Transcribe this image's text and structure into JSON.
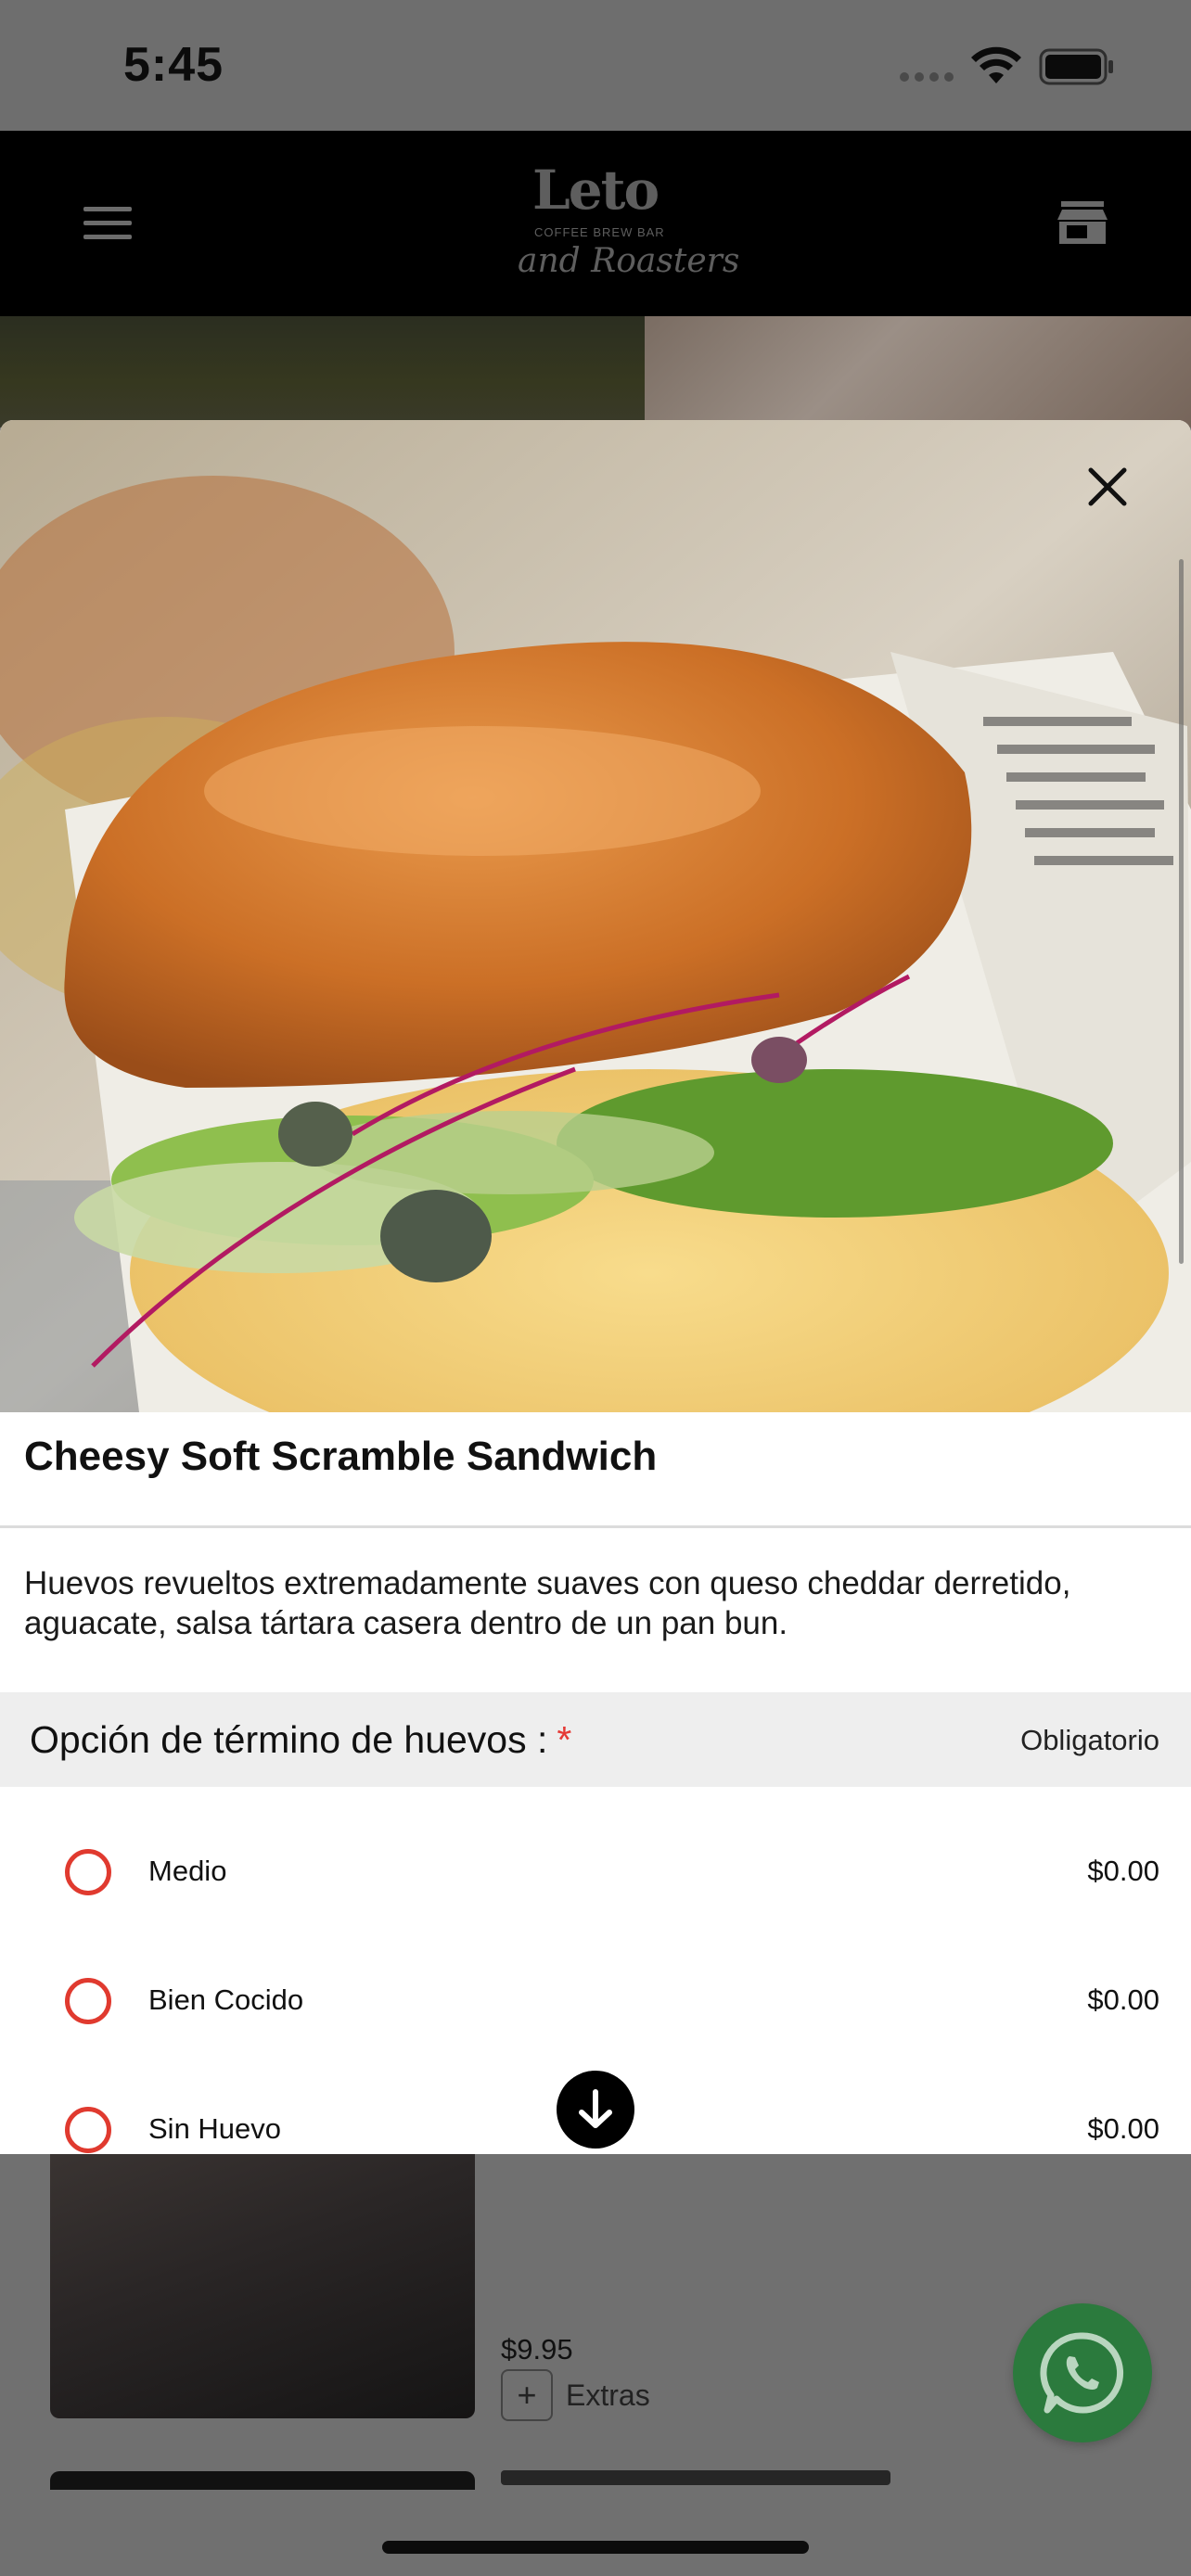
{
  "status_bar": {
    "time": "5:45"
  },
  "header": {
    "logo_main": "Leto",
    "logo_sub": "COFFEE BREW BAR",
    "logo_script": "and Roasters"
  },
  "product": {
    "title": "Cheesy Soft Scramble Sandwich",
    "description": "Huevos revueltos extremadamente suaves con queso cheddar derretido, aguacate, salsa tártara casera dentro de un pan bun."
  },
  "option_group": {
    "title": "Opción de término de huevos :",
    "required_mark": "*",
    "required_label": "Obligatorio",
    "options": [
      {
        "label": "Medio",
        "price": "$0.00"
      },
      {
        "label": "Bien Cocido",
        "price": "$0.00"
      },
      {
        "label": "Sin Huevo",
        "price": "$0.00"
      }
    ]
  },
  "background_item": {
    "price": "$9.95",
    "extras_label": "Extras",
    "extras_symbol": "+"
  },
  "colors": {
    "accent_red": "#e03a2f",
    "whatsapp_green": "#2b7a3d",
    "header_bg": "#000000"
  },
  "icons": [
    "menu-icon",
    "store-icon",
    "close-icon",
    "arrow-down-icon",
    "whatsapp-icon",
    "wifi-icon",
    "battery-icon"
  ]
}
